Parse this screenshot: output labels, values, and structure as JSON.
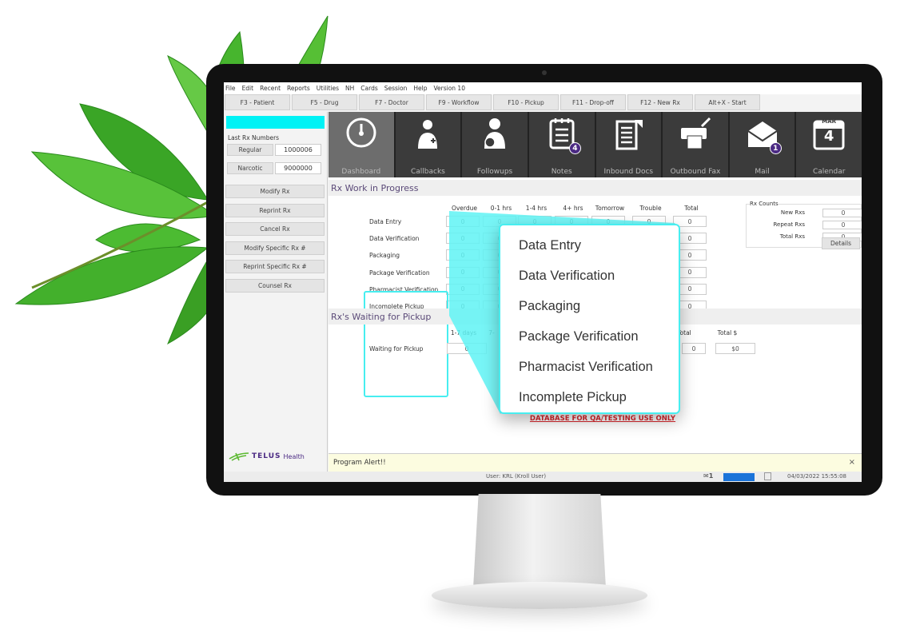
{
  "menu": [
    "File",
    "Edit",
    "Recent",
    "Reports",
    "Utilities",
    "NH",
    "Cards",
    "Session",
    "Help",
    "Version 10"
  ],
  "fkeys": [
    "F3 - Patient",
    "F5 - Drug",
    "F7 - Doctor",
    "F9 - Workflow",
    "F10 - Pickup",
    "F11 - Drop-off",
    "F12 - New Rx",
    "Alt+X - Start"
  ],
  "left": {
    "last_rx_label": "Last Rx Numbers",
    "regular_label": "Regular",
    "regular_value": "1000006",
    "narcotic_label": "Narcotic",
    "narcotic_value": "9000000",
    "buttons": [
      "Modify Rx",
      "Reprint Rx",
      "Cancel Rx",
      "Modify Specific Rx #",
      "Reprint Specific Rx #",
      "Counsel Rx"
    ],
    "logo": "TELUS Health"
  },
  "tiles": [
    {
      "label": "Dashboard",
      "icon": "gauge-icon",
      "active": true
    },
    {
      "label": "Callbacks",
      "icon": "doctor-icon"
    },
    {
      "label": "Followups",
      "icon": "person-clock-icon"
    },
    {
      "label": "Notes",
      "icon": "notepad-icon",
      "badge": "4"
    },
    {
      "label": "Inbound Docs",
      "icon": "inbound-doc-icon"
    },
    {
      "label": "Outbound Fax",
      "icon": "fax-icon"
    },
    {
      "label": "Mail",
      "icon": "mail-icon",
      "badge": "1"
    },
    {
      "label": "Calendar",
      "icon": "calendar-icon",
      "month": "MAR",
      "day": "4"
    }
  ],
  "wip": {
    "title": "Rx Work in Progress",
    "columns": [
      "Overdue",
      "0-1 hrs",
      "1-4 hrs",
      "4+ hrs",
      "Tomorrow",
      "Trouble",
      "Total"
    ],
    "rows": [
      {
        "label": "Data Entry",
        "values": [
          "0",
          "0",
          "0",
          "0",
          "0",
          "0",
          "0"
        ]
      },
      {
        "label": "Data Verification",
        "values": [
          "0",
          "0",
          "0",
          "0",
          "0",
          "0",
          "0"
        ]
      },
      {
        "label": "Packaging",
        "values": [
          "0",
          "0",
          "0",
          "0",
          "0",
          "0",
          "0"
        ]
      },
      {
        "label": "Package Verification",
        "values": [
          "0",
          "0",
          "0",
          "0",
          "0",
          "0",
          "0"
        ]
      },
      {
        "label": "Pharmacist Verification",
        "values": [
          "0",
          "0",
          "0",
          "0",
          "0",
          "0",
          "0"
        ]
      },
      {
        "label": "Incomplete Pickup",
        "values": [
          "0",
          "0",
          "0",
          "0",
          "0",
          "0",
          "0"
        ]
      }
    ]
  },
  "counts": {
    "title": "Rx Counts",
    "items": [
      {
        "label": "New Rxs",
        "value": "0"
      },
      {
        "label": "Repeat Rxs",
        "value": "0"
      },
      {
        "label": "Total Rxs",
        "value": "0"
      }
    ],
    "details": "Details"
  },
  "pickup": {
    "title": "Rx's Waiting for Pickup",
    "col1": "1-7 days",
    "col2": "7-",
    "total": "Total",
    "total_dollar": "Total $",
    "row_label": "Waiting for Pickup",
    "v1": "0",
    "v_total": "0",
    "v_dollar": "$0"
  },
  "warning": "DATABASE FOR QA/TESTING USE ONLY",
  "alert": "Program Alert!!",
  "status": {
    "user": "User: KRL (Kroll User)",
    "mail_count": "1",
    "datetime": "04/03/2022 15:55:08"
  },
  "popup": [
    "Data Entry",
    "Data Verification",
    "Packaging",
    "Package Verification",
    "Pharmacist Verification",
    "Incomplete Pickup"
  ],
  "colors": {
    "accent_cyan": "#00f2f5",
    "badge": "#4b2a83",
    "warning": "#d9262b",
    "tile": "#3b3b3b"
  }
}
